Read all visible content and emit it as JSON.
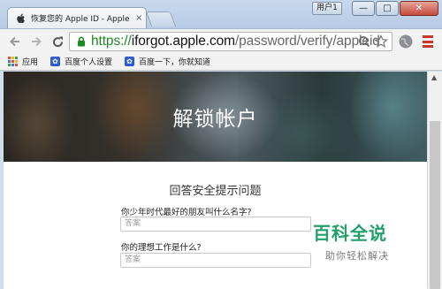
{
  "browser": {
    "tab": {
      "title": "恢复您的 Apple ID - Apple (",
      "close_glyph": "×",
      "favicon": "apple-icon"
    },
    "profile_button_label": "用户1",
    "window_controls": {
      "minimize": "—",
      "maximize": "□",
      "close": "✕"
    },
    "address": {
      "scheme": "https://",
      "host": "iforgot.apple.com",
      "path": "/password/verify/appleid"
    }
  },
  "bookmarks": [
    {
      "label": "应用",
      "icon": "apps-grid-icon"
    },
    {
      "label": "百度个人设置",
      "icon": "baidu-paw-icon"
    },
    {
      "label": "百度一下，你就知道",
      "icon": "baidu-paw-icon"
    }
  ],
  "page": {
    "hero_title": "解锁帐户",
    "form_heading": "回答安全提示问题",
    "questions": [
      {
        "label": "你少年时代最好的朋友叫什么名字?",
        "placeholder": "答案"
      },
      {
        "label": "你的理想工作是什么?",
        "placeholder": "答案"
      }
    ]
  },
  "watermark": {
    "title": "百科全说",
    "subtitle": "助你轻松解决"
  },
  "colors": {
    "url_scheme": "#1a8a21",
    "menu_icon": "#c6362a",
    "watermark": "#22a06b"
  }
}
